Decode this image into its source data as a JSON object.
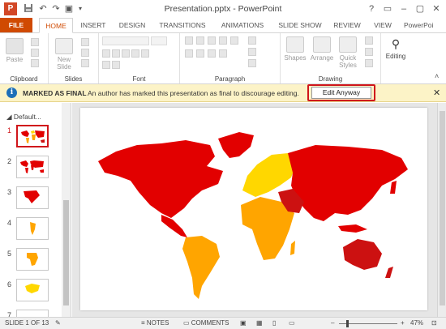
{
  "window": {
    "title": "Presentation.pptx - PowerPoint",
    "app_logo": "P",
    "quick_access": [
      "save-icon",
      "undo-icon",
      "redo-icon",
      "presentation-icon",
      "customize-icon"
    ],
    "controls": [
      "?",
      "▭",
      "–",
      "▢",
      "✕"
    ]
  },
  "tabs": [
    "FILE",
    "HOME",
    "INSERT",
    "DESIGN",
    "TRANSITIONS",
    "ANIMATIONS",
    "SLIDE SHOW",
    "REVIEW",
    "VIEW",
    "PowerPoi"
  ],
  "ribbon": {
    "paste": "Paste",
    "new_slide": "New Slide",
    "shapes": "Shapes",
    "arrange": "Arrange",
    "quick_styles": "Quick Styles",
    "editing": "Editing",
    "groups": {
      "clipboard": "Clipboard",
      "slides": "Slides",
      "font": "Font",
      "paragraph": "Paragraph",
      "drawing": "Drawing"
    }
  },
  "infobar": {
    "title": "MARKED AS FINAL",
    "message": "An author has marked this presentation as final to discourage editing.",
    "button": "Edit Anyway",
    "close": "✕"
  },
  "thumbnails": {
    "section": "Default...",
    "numbers": [
      "1",
      "2",
      "3",
      "4",
      "5",
      "6",
      "7"
    ]
  },
  "statusbar": {
    "slide_info": "SLIDE 1 OF 13",
    "notes": "NOTES",
    "comments": "COMMENTS",
    "zoom": "47%"
  },
  "colors": {
    "accent": "#d04a02",
    "map_red": "#e20000",
    "map_yellow": "#ffd700",
    "map_orange": "#ffa500",
    "map_darkred": "#cc1111",
    "highlight": "#d0161b"
  }
}
